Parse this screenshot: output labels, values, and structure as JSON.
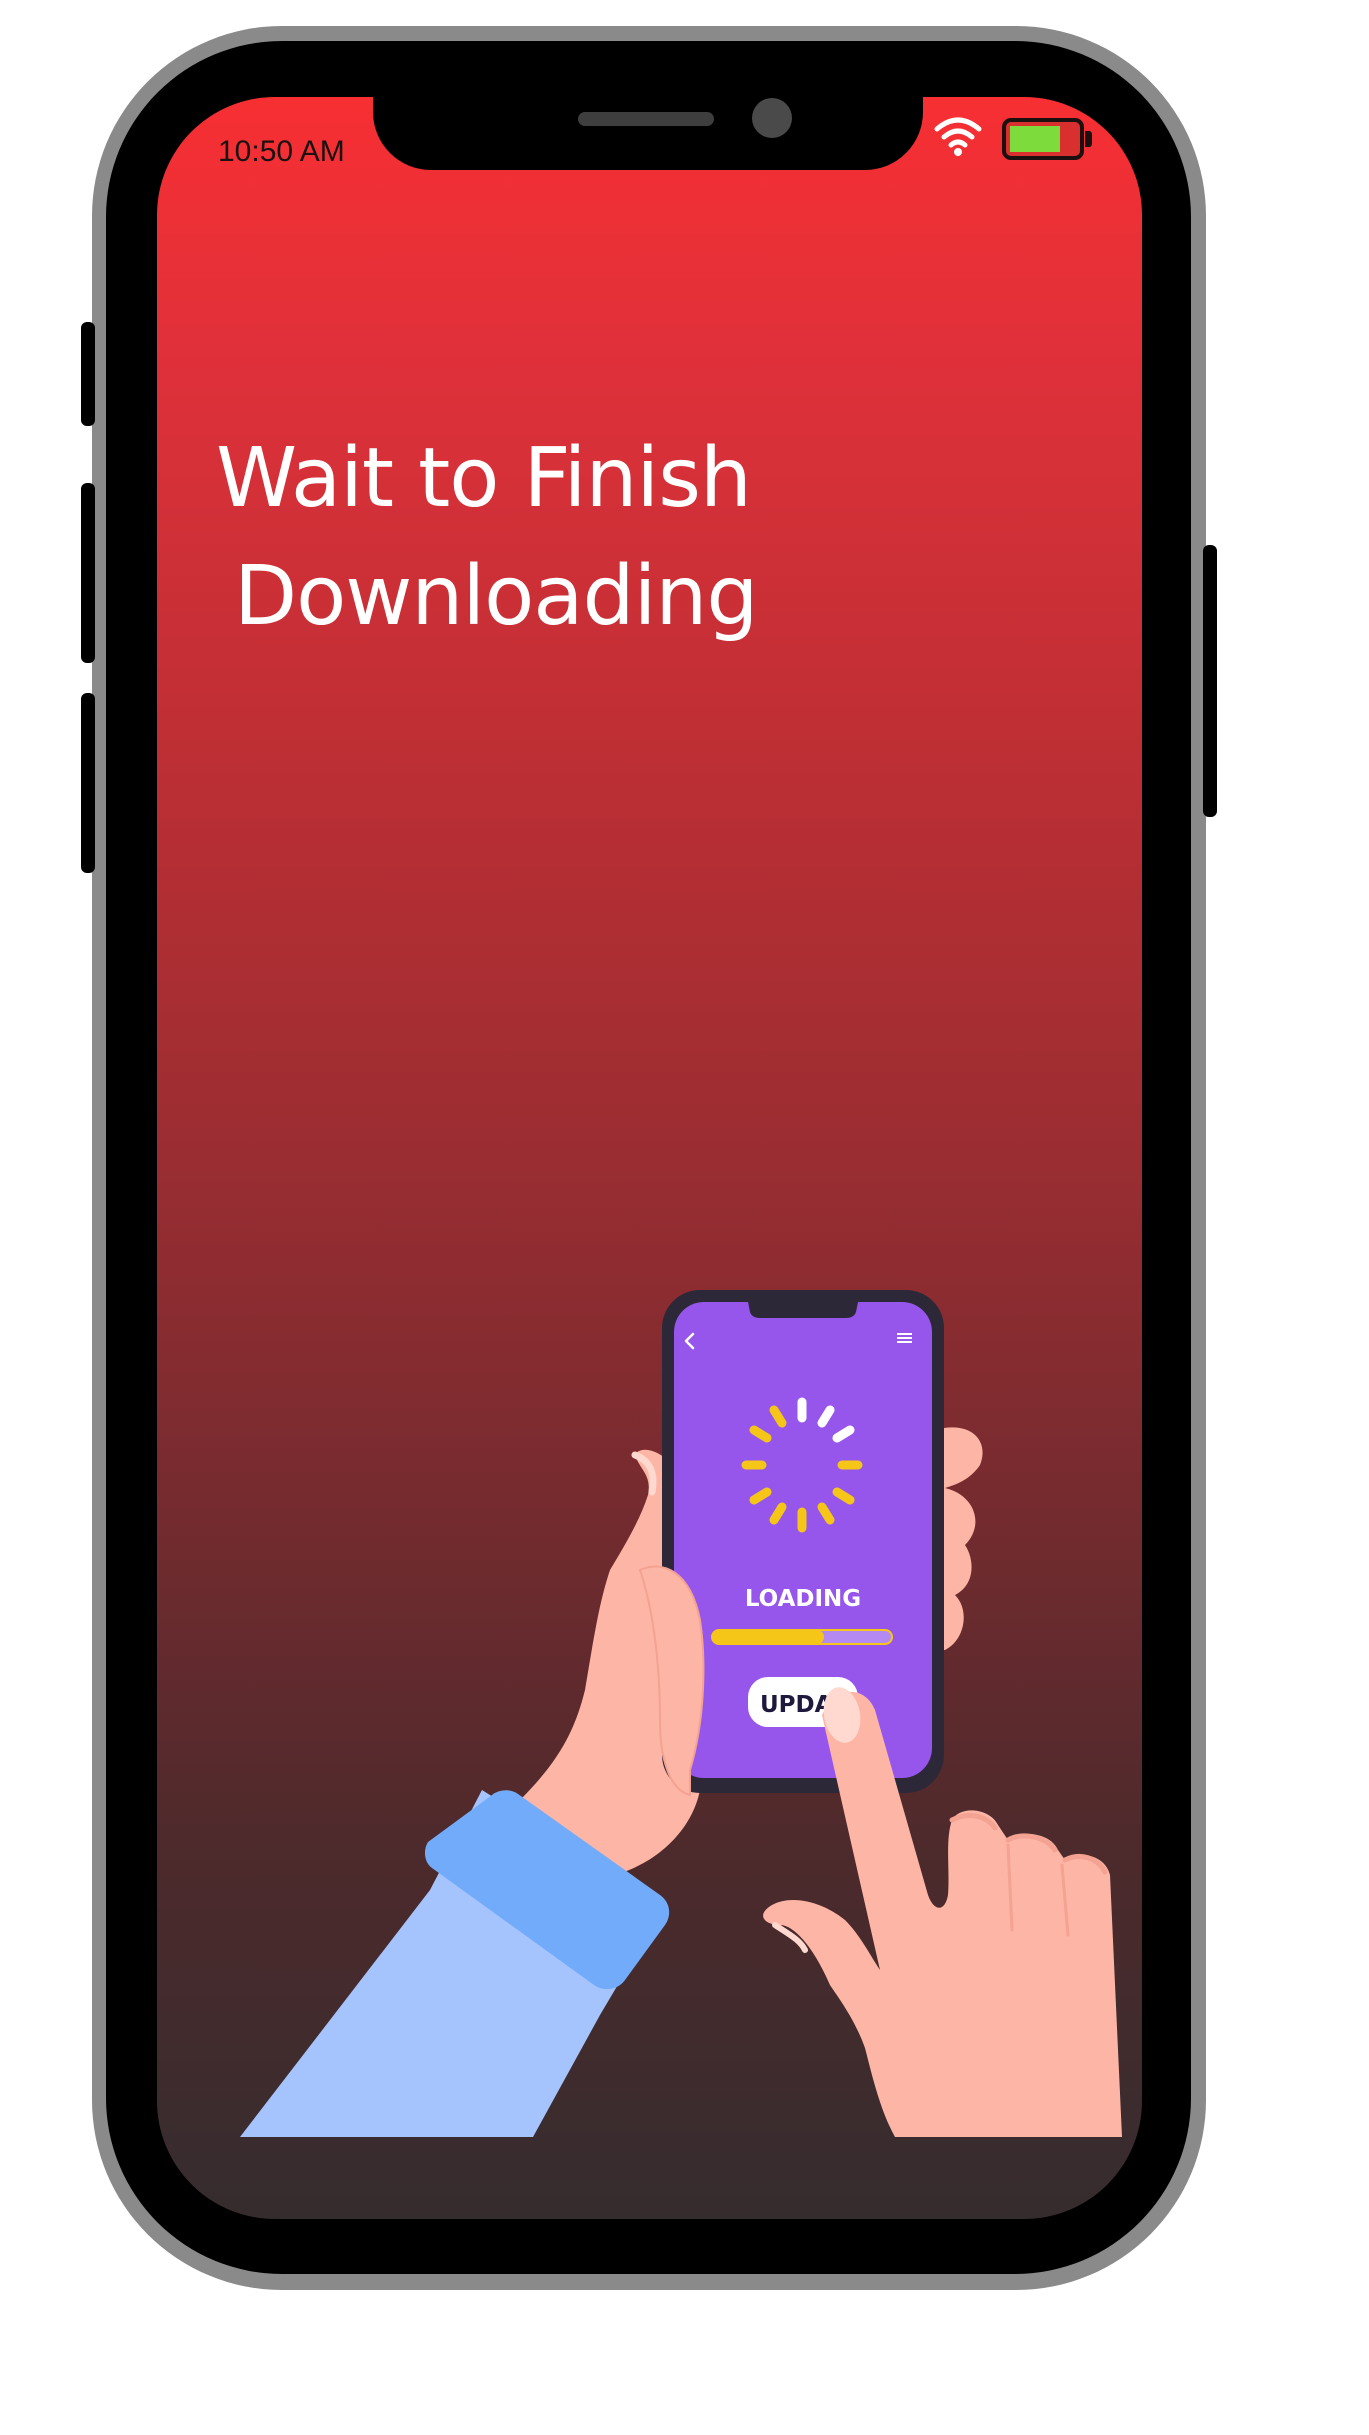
{
  "status_bar": {
    "time": "10:50 AM",
    "wifi_icon": "wifi-icon",
    "battery_icon": "battery-icon"
  },
  "headline": {
    "line1": "Wait to Finish",
    "line2": "Downloading"
  },
  "illustration": {
    "loading_label": "LOADING",
    "update_button_label": "UPDA",
    "progress": 0.62,
    "back_icon": "chevron-left-icon",
    "menu_icon": "menu-icon",
    "spinner_icon": "spinner-icon"
  },
  "colors": {
    "gradient_top": "#f72f33",
    "gradient_bottom": "#352c2e",
    "inner_phone_screen": "#9656ec",
    "spinner_active": "#f5c518",
    "skin": "#fdb5a6",
    "sleeve": "#a5c4fd",
    "cuff": "#73abfb"
  }
}
